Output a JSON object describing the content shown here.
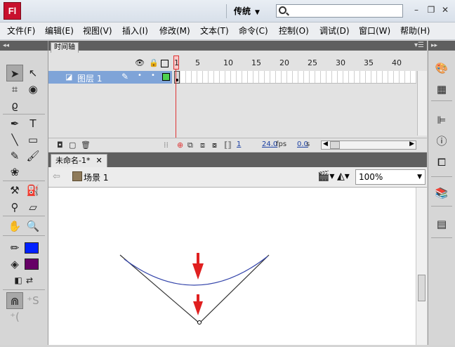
{
  "app": {
    "logo_text": "Fl",
    "workspace_label": "传统",
    "search_placeholder": "",
    "window_controls": [
      "minimize-icon",
      "restore-icon",
      "close-icon"
    ]
  },
  "menu": {
    "items": [
      "文件(F)",
      "编辑(E)",
      "视图(V)",
      "插入(I)",
      "修改(M)",
      "文本(T)",
      "命令(C)",
      "控制(O)",
      "调试(D)",
      "窗口(W)",
      "帮助(H)"
    ]
  },
  "timeline": {
    "tab_label": "时间轴",
    "frame_numbers": [
      "1",
      "5",
      "10",
      "15",
      "20",
      "25",
      "30",
      "35",
      "40"
    ],
    "layer_name": "图层 1",
    "current_frame": "1",
    "fps": "24.0",
    "fps_unit": "fps",
    "time": "0.0",
    "time_unit": "s"
  },
  "document": {
    "tab_label": "未命名-1*",
    "scene_label": "场景 1",
    "zoom": "100%"
  },
  "stage": {
    "colors": {
      "curve": "#3344aa",
      "lines": "#333333",
      "arrows": "#e02020"
    }
  },
  "tools": {
    "stroke_color": "#0020ff",
    "fill_color": "#660066"
  }
}
